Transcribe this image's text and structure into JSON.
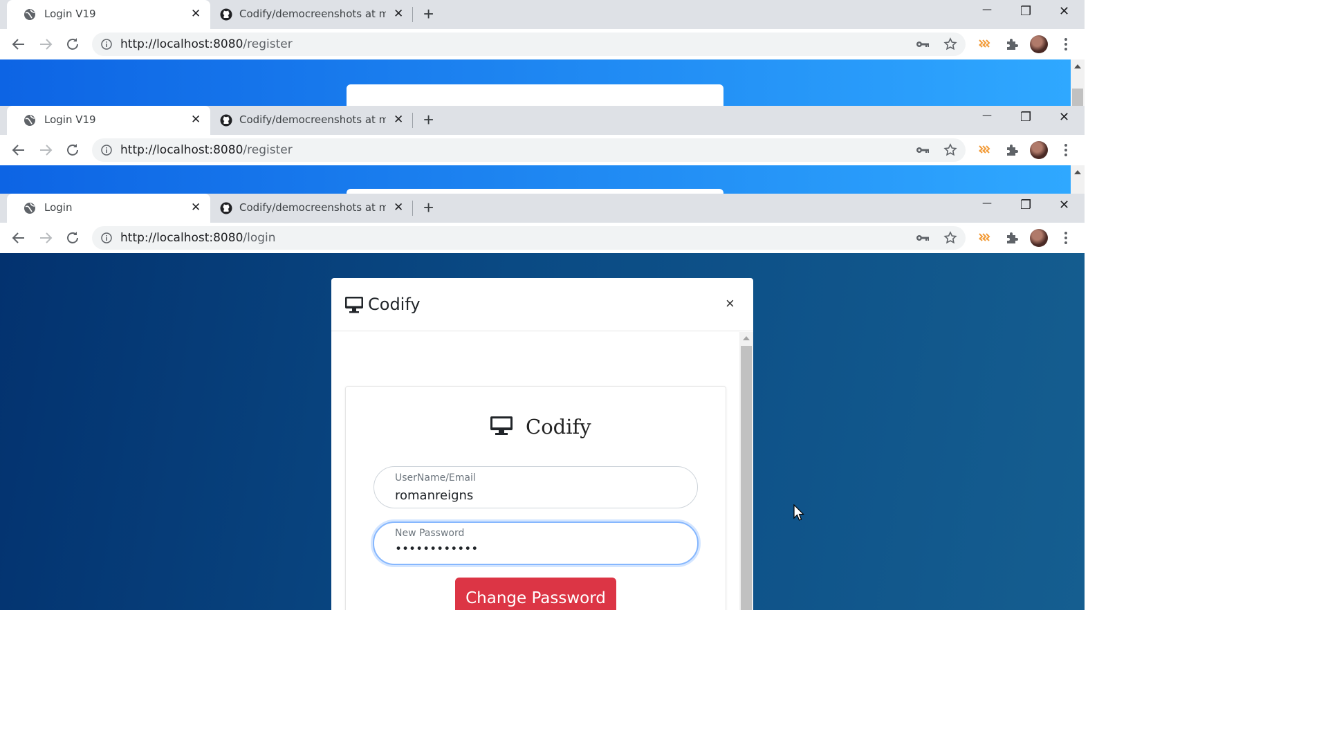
{
  "windows": [
    {
      "tabs": [
        {
          "title": "Login V19",
          "active": true,
          "favicon": "globe-icon"
        },
        {
          "title": "Codify/democreenshots at main",
          "active": false,
          "favicon": "github-icon"
        }
      ],
      "url_host": "http://localhost:8080",
      "url_path": "/register"
    },
    {
      "tabs": [
        {
          "title": "Login V19",
          "active": true,
          "favicon": "globe-icon"
        },
        {
          "title": "Codify/democreenshots at main",
          "active": false,
          "favicon": "github-icon"
        }
      ],
      "url_host": "http://localhost:8080",
      "url_path": "/register"
    },
    {
      "tabs": [
        {
          "title": "Login",
          "active": true,
          "favicon": "globe-icon"
        },
        {
          "title": "Codify/democreenshots at main",
          "active": false,
          "favicon": "github-icon"
        }
      ],
      "url_host": "http://localhost:8080",
      "url_path": "/login"
    }
  ],
  "window_controls": {
    "minimize": "—",
    "restore": "❐",
    "close": "✕"
  },
  "modal": {
    "title": "Codify",
    "close_label": "×",
    "brand_name": "Codify",
    "username_label": "UserName/Email",
    "username_value": "romanreigns",
    "password_label": "New Password",
    "password_value": "••••••••••••",
    "submit_label": "Change Password"
  },
  "colors": {
    "brand_blue_start": "#0d64e4",
    "brand_blue_end": "#2fa8ff",
    "navy_start": "#03326f",
    "navy_end": "#155e90",
    "danger": "#dc3545",
    "focus": "#86b7fe"
  }
}
